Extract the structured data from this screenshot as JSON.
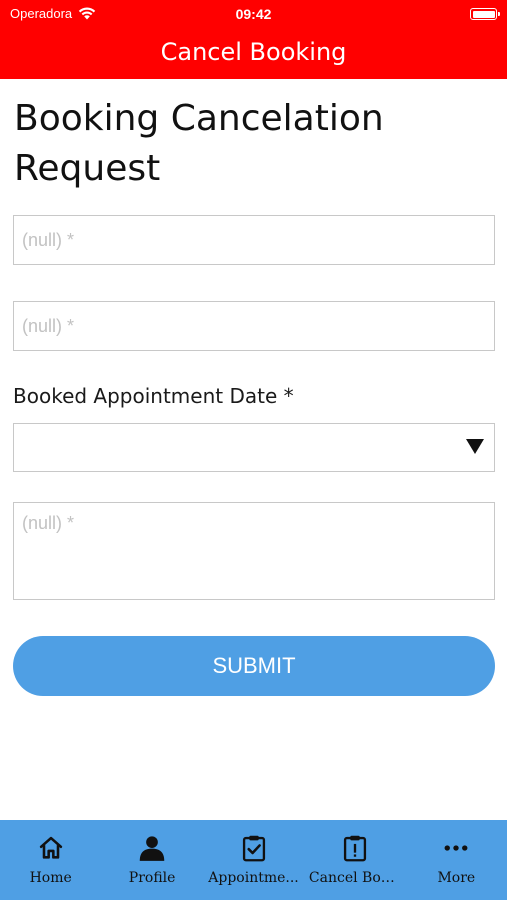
{
  "status_bar": {
    "carrier": "Operadora",
    "time": "09:42"
  },
  "nav": {
    "title": "Cancel Booking"
  },
  "form": {
    "title": "Booking Cancelation Request",
    "field1_placeholder": "(null) *",
    "field2_placeholder": "(null) *",
    "date_label": "Booked Appointment Date *",
    "date_value": "",
    "message_placeholder": "(null) *",
    "submit_label": "SUBMIT"
  },
  "tabs": [
    {
      "label": "Home",
      "icon": "home-icon"
    },
    {
      "label": "Profile",
      "icon": "person-icon"
    },
    {
      "label": "Appointme...",
      "icon": "clipboard-check-icon"
    },
    {
      "label": "Cancel Boo...",
      "icon": "clipboard-alert-icon"
    },
    {
      "label": "More",
      "icon": "more-icon"
    }
  ],
  "colors": {
    "header": "#ff0000",
    "accent": "#4f9fe4"
  }
}
